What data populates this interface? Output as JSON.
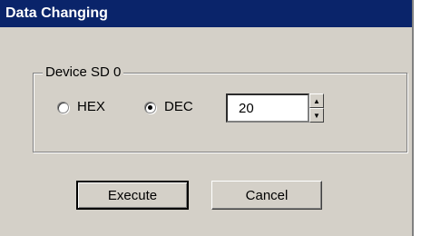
{
  "window": {
    "title": "Data Changing"
  },
  "group": {
    "label": "Device SD 0",
    "radios": [
      {
        "label": "HEX",
        "checked": false
      },
      {
        "label": "DEC",
        "checked": true
      }
    ],
    "spinner": {
      "value": "20",
      "up_icon": "arrow-up",
      "down_icon": "arrow-down"
    }
  },
  "buttons": {
    "execute_label": "Execute",
    "cancel_label": "Cancel"
  }
}
